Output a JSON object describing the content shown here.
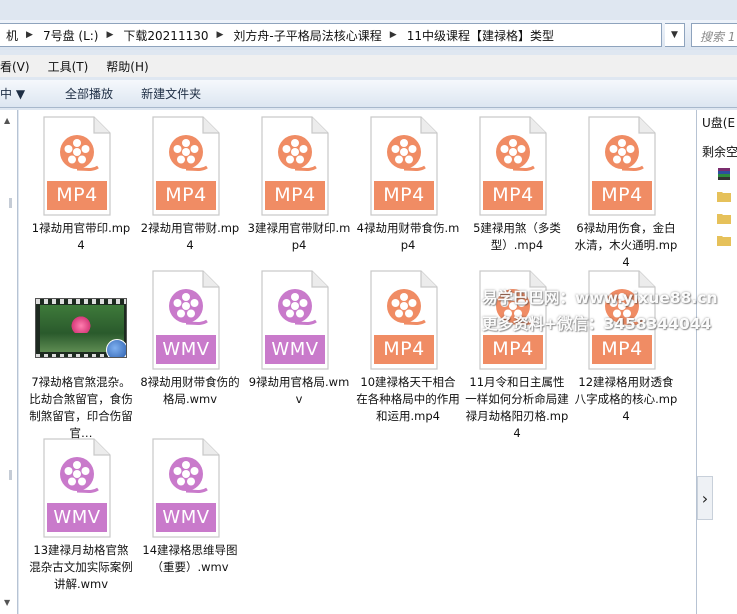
{
  "address": {
    "crumbs": [
      "机",
      "7号盘 (L:)",
      "下载20211130",
      "刘方舟-子平格局法核心课程",
      "11中级课程【建禄格】类型"
    ],
    "search_placeholder": "搜索 1"
  },
  "menu": [
    "看(V)",
    "工具(T)",
    "帮助(H)"
  ],
  "toolbar": {
    "organize_partial": "中 ▼",
    "play_all": "全部播放",
    "new_folder": "新建文件夹"
  },
  "files": [
    {
      "name": "1禄劫用官带印.mp4",
      "type": "MP4"
    },
    {
      "name": "2禄劫用官带财.mp4",
      "type": "MP4"
    },
    {
      "name": "3建禄用官带财印.mp4",
      "type": "MP4"
    },
    {
      "name": "4禄劫用财带食伤.mp4",
      "type": "MP4"
    },
    {
      "name": "5建禄用煞（多类型）.mp4",
      "type": "MP4"
    },
    {
      "name": "6禄劫用伤食，金白水清，木火通明.mp4",
      "type": "MP4"
    },
    {
      "name": "7禄劫格官煞混杂。比劫合煞留官，食伤制煞留官，印合伤留官…",
      "type": "THUMB"
    },
    {
      "name": "8禄劫用财带食伤的格局.wmv",
      "type": "WMV"
    },
    {
      "name": "9禄劫用官格局.wmv",
      "type": "WMV"
    },
    {
      "name": "10建禄格天干相合在各种格局中的作用和运用.mp4",
      "type": "MP4"
    },
    {
      "name": "11月令和日主属性一样如何分析命局建禄月劫格阳刃格.mp4",
      "type": "MP4"
    },
    {
      "name": "12建禄格用财透食八字成格的核心.mp4",
      "type": "MP4"
    },
    {
      "name": "13建禄月劫格官煞混杂古文加实际案例讲解.wmv",
      "type": "WMV"
    },
    {
      "name": "14建禄格思维导图（重要）.wmv",
      "type": "WMV"
    }
  ],
  "right_pane": {
    "title": "U盘(E",
    "subtitle": "剩余空"
  },
  "watermark": {
    "line1": "易学巴巴网：www.yixue88.cn",
    "line2": "更多资料+微信：3458344044"
  },
  "colors": {
    "mp4_badge": "#f08c64",
    "wmv_badge": "#c97acb",
    "mp4_reel": "#f08c64",
    "wmv_reel": "#c97acb"
  }
}
